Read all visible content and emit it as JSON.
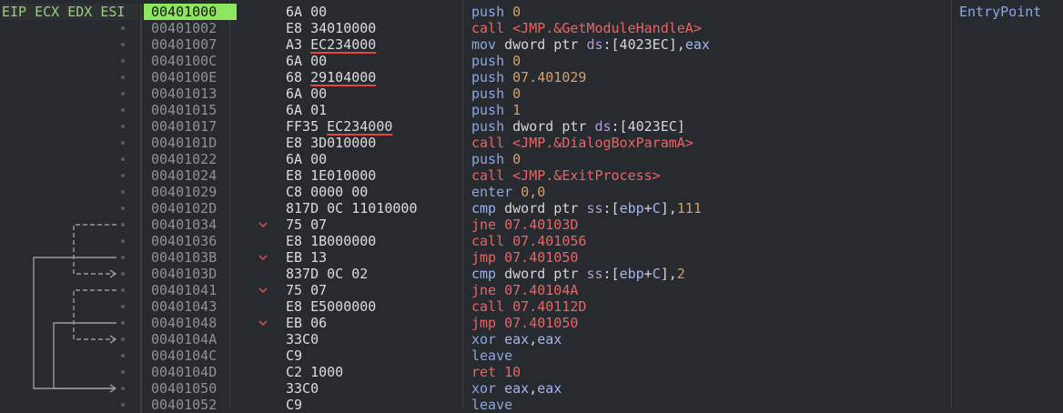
{
  "header": {
    "registers_label": "EIP ECX EDX ESI"
  },
  "rows": [
    {
      "addr": "00401000",
      "bytes": "6A 00",
      "instr": [
        {
          "t": "push ",
          "c": "m"
        },
        {
          "t": "0",
          "c": "num"
        }
      ],
      "comment": "EntryPoint",
      "eip": true
    },
    {
      "addr": "00401002",
      "bytes": "E8 34010000",
      "instr": [
        {
          "t": "call ",
          "c": "call"
        },
        {
          "t": "<JMP.&GetModuleHandleA>",
          "c": "call"
        }
      ]
    },
    {
      "addr": "00401007",
      "bytes": "A3 ",
      "bytes_u": "EC234000",
      "instr": [
        {
          "t": "mov ",
          "c": "m"
        },
        {
          "t": "dword ptr ",
          "c": "plain"
        },
        {
          "t": "ds",
          "c": "seg"
        },
        {
          "t": ":[4023EC],",
          "c": "plain"
        },
        {
          "t": "eax",
          "c": "reg"
        }
      ]
    },
    {
      "addr": "0040100C",
      "bytes": "6A 00",
      "instr": [
        {
          "t": "push ",
          "c": "m"
        },
        {
          "t": "0",
          "c": "num"
        }
      ]
    },
    {
      "addr": "0040100E",
      "bytes": "68 ",
      "bytes_u": "29104000",
      "instr": [
        {
          "t": "push ",
          "c": "m"
        },
        {
          "t": "07.401029",
          "c": "num"
        }
      ]
    },
    {
      "addr": "00401013",
      "bytes": "6A 00",
      "instr": [
        {
          "t": "push ",
          "c": "m"
        },
        {
          "t": "0",
          "c": "num"
        }
      ]
    },
    {
      "addr": "00401015",
      "bytes": "6A 01",
      "instr": [
        {
          "t": "push ",
          "c": "m"
        },
        {
          "t": "1",
          "c": "num"
        }
      ]
    },
    {
      "addr": "00401017",
      "bytes": "FF35 ",
      "bytes_u": "EC234000",
      "instr": [
        {
          "t": "push ",
          "c": "m"
        },
        {
          "t": "dword ptr ",
          "c": "plain"
        },
        {
          "t": "ds",
          "c": "seg"
        },
        {
          "t": ":[4023EC]",
          "c": "plain"
        }
      ]
    },
    {
      "addr": "0040101D",
      "bytes": "E8 3D010000",
      "instr": [
        {
          "t": "call ",
          "c": "call"
        },
        {
          "t": "<JMP.&DialogBoxParamA>",
          "c": "call"
        }
      ]
    },
    {
      "addr": "00401022",
      "bytes": "6A 00",
      "instr": [
        {
          "t": "push ",
          "c": "m"
        },
        {
          "t": "0",
          "c": "num"
        }
      ]
    },
    {
      "addr": "00401024",
      "bytes": "E8 1E010000",
      "instr": [
        {
          "t": "call ",
          "c": "call"
        },
        {
          "t": "<JMP.&ExitProcess>",
          "c": "call"
        }
      ]
    },
    {
      "addr": "00401029",
      "bytes": "C8 0000 00",
      "instr": [
        {
          "t": "enter ",
          "c": "m"
        },
        {
          "t": "0,0",
          "c": "num"
        }
      ]
    },
    {
      "addr": "0040102D",
      "bytes": "817D 0C 11010000",
      "instr": [
        {
          "t": "cmp ",
          "c": "cmp"
        },
        {
          "t": "dword ptr ",
          "c": "plain"
        },
        {
          "t": "ss",
          "c": "seg"
        },
        {
          "t": ":[",
          "c": "plain"
        },
        {
          "t": "ebp",
          "c": "reg"
        },
        {
          "t": "+",
          "c": "plain"
        },
        {
          "t": "C",
          "c": "reg"
        },
        {
          "t": "],",
          "c": "plain"
        },
        {
          "t": "111",
          "c": "num"
        }
      ]
    },
    {
      "addr": "00401034",
      "bytes": "75 07",
      "chev": true,
      "instr": [
        {
          "t": "jne ",
          "c": "jmp"
        },
        {
          "t": "07.40103D",
          "c": "jmp"
        }
      ]
    },
    {
      "addr": "00401036",
      "bytes": "E8 1B000000",
      "instr": [
        {
          "t": "call ",
          "c": "call"
        },
        {
          "t": "07.401056",
          "c": "call"
        }
      ]
    },
    {
      "addr": "0040103B",
      "bytes": "EB 13",
      "chev": true,
      "instr": [
        {
          "t": "jmp ",
          "c": "jmp"
        },
        {
          "t": "07.401050",
          "c": "jmp"
        }
      ]
    },
    {
      "addr": "0040103D",
      "bytes": "837D 0C 02",
      "instr": [
        {
          "t": "cmp ",
          "c": "cmp"
        },
        {
          "t": "dword ptr ",
          "c": "plain"
        },
        {
          "t": "ss",
          "c": "seg"
        },
        {
          "t": ":[",
          "c": "plain"
        },
        {
          "t": "ebp",
          "c": "reg"
        },
        {
          "t": "+",
          "c": "plain"
        },
        {
          "t": "C",
          "c": "reg"
        },
        {
          "t": "],",
          "c": "plain"
        },
        {
          "t": "2",
          "c": "num"
        }
      ]
    },
    {
      "addr": "00401041",
      "bytes": "75 07",
      "chev": true,
      "instr": [
        {
          "t": "jne ",
          "c": "jmp"
        },
        {
          "t": "07.40104A",
          "c": "jmp"
        }
      ]
    },
    {
      "addr": "00401043",
      "bytes": "E8 E5000000",
      "instr": [
        {
          "t": "call ",
          "c": "call"
        },
        {
          "t": "07.40112D",
          "c": "call"
        }
      ]
    },
    {
      "addr": "00401048",
      "bytes": "EB 06",
      "chev": true,
      "instr": [
        {
          "t": "jmp ",
          "c": "jmp"
        },
        {
          "t": "07.401050",
          "c": "jmp"
        }
      ]
    },
    {
      "addr": "0040104A",
      "bytes": "33C0",
      "instr": [
        {
          "t": "xor ",
          "c": "m"
        },
        {
          "t": "eax",
          "c": "reg"
        },
        {
          "t": ",",
          "c": "plain"
        },
        {
          "t": "eax",
          "c": "reg"
        }
      ]
    },
    {
      "addr": "0040104C",
      "bytes": "C9",
      "instr": [
        {
          "t": "leave",
          "c": "m"
        }
      ]
    },
    {
      "addr": "0040104D",
      "bytes": "C2 1000",
      "instr": [
        {
          "t": "ret ",
          "c": "call"
        },
        {
          "t": "10",
          "c": "call"
        }
      ]
    },
    {
      "addr": "00401050",
      "bytes": "33C0",
      "instr": [
        {
          "t": "xor ",
          "c": "m"
        },
        {
          "t": "eax",
          "c": "reg"
        },
        {
          "t": ",",
          "c": "plain"
        },
        {
          "t": "eax",
          "c": "reg"
        }
      ]
    },
    {
      "addr": "00401052",
      "bytes": "C9",
      "instr": [
        {
          "t": "leave",
          "c": "m"
        }
      ]
    }
  ],
  "colors": {
    "background": "#272a2e",
    "eip_highlight": "#8ee660",
    "call_jump": "#e66767",
    "mnemonic": "#8ea6e0",
    "number": "#d6a06a",
    "comment": "#8fa6e6"
  }
}
